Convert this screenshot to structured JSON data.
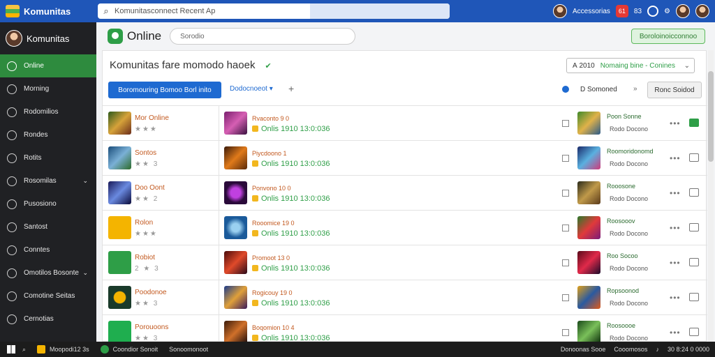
{
  "topbar": {
    "app_name": "Komunitas",
    "search_placeholder": "Komunitasconnect Recent Ap",
    "user_label": "Accessorias",
    "badge_count": "61",
    "mini_label": "83"
  },
  "sidebar": {
    "header": "Komunitas",
    "items": [
      {
        "label": "Online",
        "active": true
      },
      {
        "label": "Morning"
      },
      {
        "label": "Rodomilios"
      },
      {
        "label": "Rondes"
      },
      {
        "label": "Rotits"
      },
      {
        "label": "Rosomilas"
      },
      {
        "label": "Pusosiono"
      },
      {
        "label": "Santost"
      },
      {
        "label": "Conntes"
      },
      {
        "label": "Omotilos Bosonte"
      },
      {
        "label": "Comotine Seitas"
      },
      {
        "label": "Cernotias"
      }
    ]
  },
  "main": {
    "title": "Online",
    "search_placeholder": "Sorodio",
    "green_button": "Boroloinoicconnoo",
    "panel_title": "Komunitas fare momodo haoek",
    "sort_box_prefix": "A",
    "sort_box_value": "2010",
    "sort_box_green": "Nomaing bine - Conines",
    "primary_button": "Boromouring Bomoo Borl inito",
    "dropdown_label": "Dodocnoeot",
    "sort_label": "D Somoned",
    "gray_button": "Ronc Soidod"
  },
  "rows": [
    {
      "name1": "Mor Online",
      "stars": "★★★",
      "name2": "Rvaconto 9 0",
      "online": "Onlis 1910 13:0:036",
      "name3": "Poon Sonne",
      "sub3": "Rodo Docono",
      "msg_active": true
    },
    {
      "name1": "Sontos",
      "stars": "★★ 3",
      "name2": "Piycdoono 1",
      "online": "Onlis 1910 13:0:036",
      "name3": "Roomoridonomd",
      "sub3": "Rodo Docono",
      "msg_active": false
    },
    {
      "name1": "Doo Oont",
      "stars": "★★ 2",
      "name2": "Ponvono 10 0",
      "online": "Onlis 1910 13:0:036",
      "name3": "Rooosone",
      "sub3": "Rodo Docono",
      "msg_active": false
    },
    {
      "name1": "Rolon",
      "stars": "★★★",
      "name2": "Rooomice 19 0",
      "online": "Onlis 1910 13:0:036",
      "name3": "Roosooov",
      "sub3": "Rodo Docono",
      "msg_active": false
    },
    {
      "name1": "Robiot",
      "stars": "2 ★ 3",
      "name2": "Promoot 13 0",
      "online": "Onlis 1910 13:0:036",
      "name3": "Roo Socoo",
      "sub3": "Rodo Docono",
      "msg_active": false
    },
    {
      "name1": "Poodonoe",
      "stars": "★★ 3",
      "name2": "Rogicouy 19 0",
      "online": "Onlis 1910 13:0:036",
      "name3": "Ropsoonod",
      "sub3": "Rodo Docono",
      "msg_active": false
    },
    {
      "name1": "Porouoons",
      "stars": "★★ 3",
      "name2": "Boqomion 10 4",
      "online": "Onlis 1910 13:0:036",
      "name3": "Roosoooe",
      "sub3": "Rodo Docono",
      "msg_active": false
    }
  ],
  "taskbar": {
    "app_title": "Moopodi12 3s",
    "item2": "Coondior Sonoit",
    "item3": "Sonoomonoot",
    "right1": "Donoonas Sooe",
    "right2": "Cooomosos",
    "clock": "30 8:24 0 0000"
  }
}
